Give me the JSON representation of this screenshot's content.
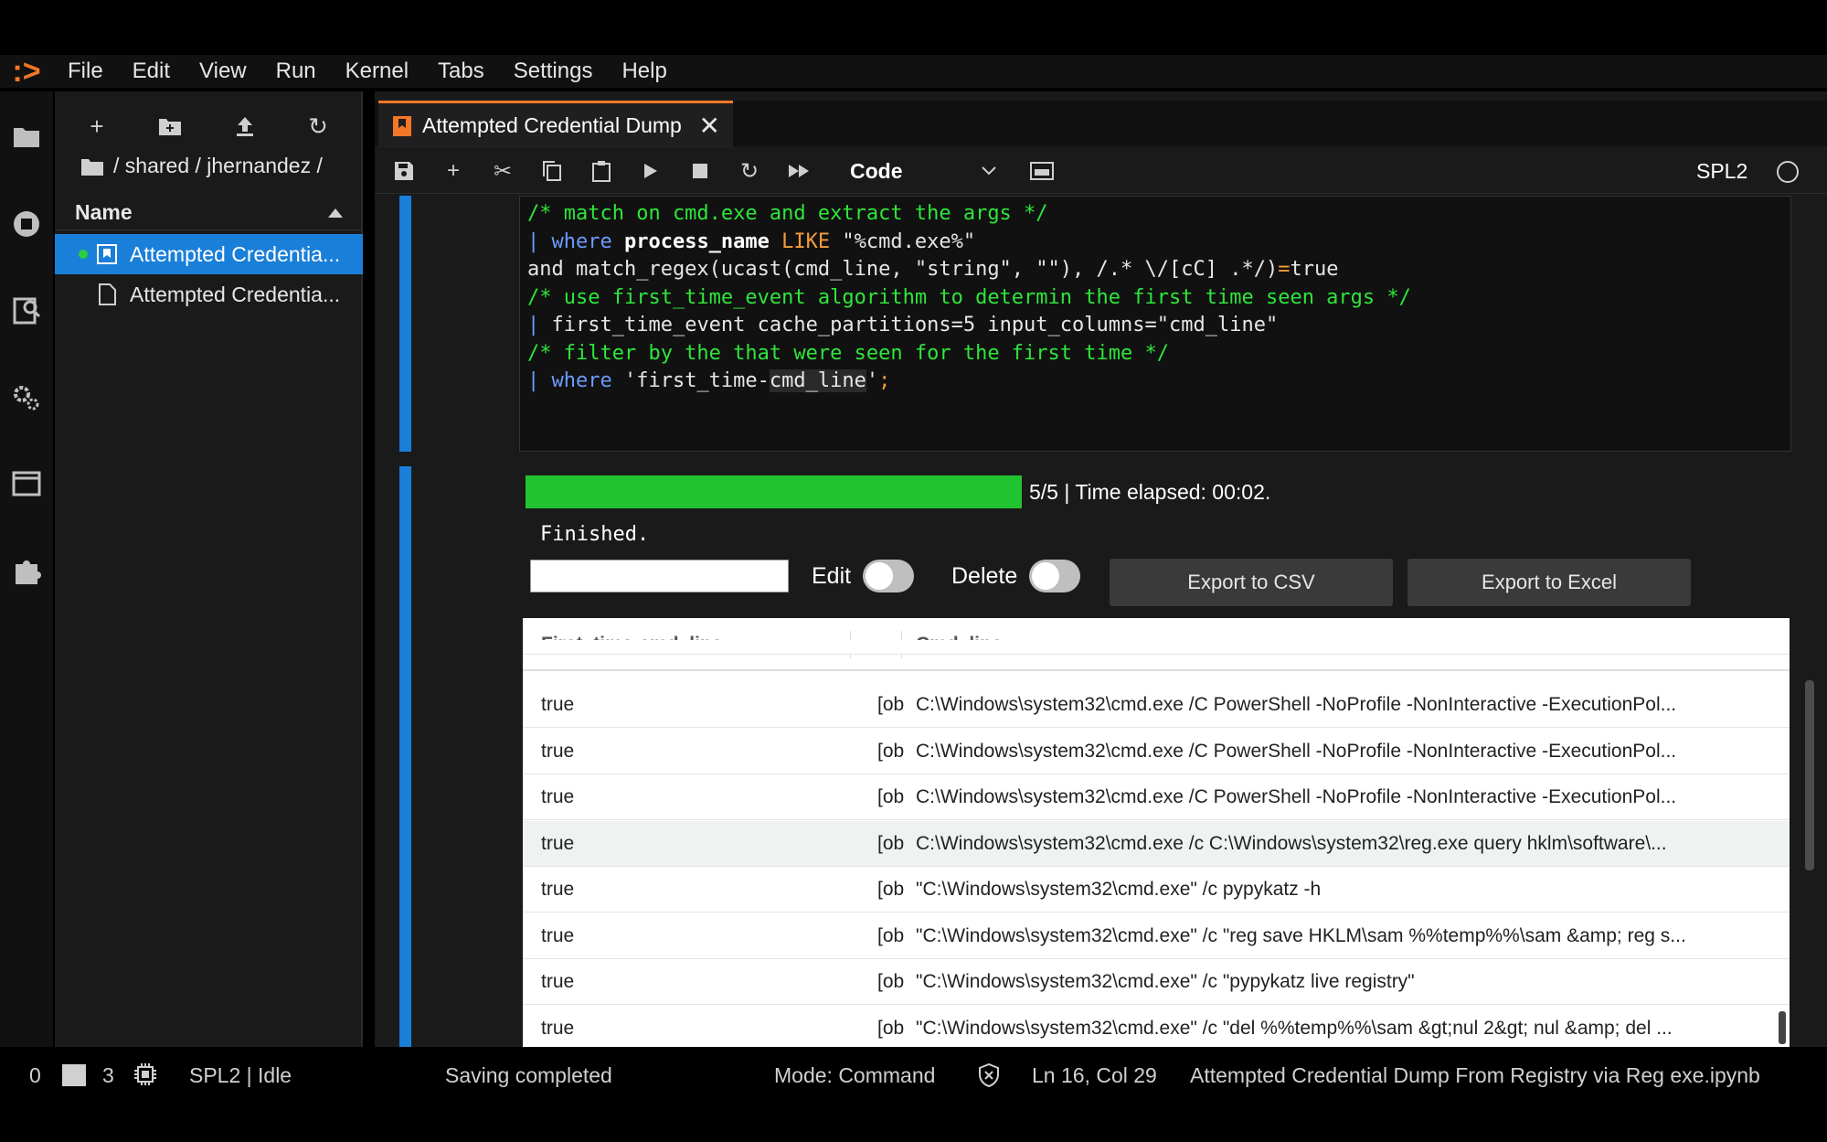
{
  "menubar": {
    "logo": ":>",
    "items": [
      "File",
      "Edit",
      "View",
      "Run",
      "Kernel",
      "Tabs",
      "Settings",
      "Help"
    ]
  },
  "activity_icons": [
    "folder-icon",
    "running-icon",
    "property-inspector-icon",
    "gear-icon",
    "window-icon",
    "extension-icon"
  ],
  "filebrowser": {
    "toolbar_icons": [
      "new-launcher-icon",
      "new-folder-icon",
      "upload-icon",
      "refresh-icon"
    ],
    "breadcrumb": "/ shared / jhernandez /",
    "column_header": "Name",
    "files": [
      {
        "name": "Attempted Credentia...",
        "selected": true,
        "running": true
      },
      {
        "name": "Attempted Credentia...",
        "selected": false,
        "running": false
      }
    ]
  },
  "tab": {
    "title": "Attempted Credential Dump",
    "accent": "#f37726"
  },
  "notebook_toolbar": {
    "cell_type": "Code",
    "kernel": "SPL2"
  },
  "code_lines": [
    "/* match on cmd.exe and extract the args */",
    "| where process_name LIKE \"%cmd.exe%\"",
    "and match_regex(ucast(cmd_line, \"string\", \"\"), /.* \\/[cC] .*/)=true",
    "/* use first_time_event algorithm to determin the first time seen args */",
    "| first_time_event cache_partitions=5 input_columns=\"cmd_line\"",
    "/* filter by the that were seen for the first time */",
    "| where 'first_time-cmd_line';"
  ],
  "output": {
    "progress_fraction": 1.0,
    "progress_color": "#22c331",
    "progress_text": "5/5 | Time elapsed: 00:02.",
    "status": "Finished.",
    "search_value": "",
    "edit_label": "Edit",
    "delete_label": "Delete",
    "export_csv_label": "Export to CSV",
    "export_excel_label": "Export to Excel"
  },
  "table": {
    "columns": [
      "First_time-cmd_line",
      "Cmd_line"
    ],
    "rows": [
      {
        "first": "true",
        "mid": "[ob",
        "cmd": "C:\\Windows\\system32\\cmd.exe /C PowerShell -NoProfile -NonInteractive -ExecutionPol..."
      },
      {
        "first": "true",
        "mid": "[ob",
        "cmd": "C:\\Windows\\system32\\cmd.exe /C PowerShell -NoProfile -NonInteractive -ExecutionPol..."
      },
      {
        "first": "true",
        "mid": "[ob",
        "cmd": "C:\\Windows\\system32\\cmd.exe /C PowerShell -NoProfile -NonInteractive -ExecutionPol..."
      },
      {
        "first": "true",
        "mid": "[ob",
        "cmd": "C:\\Windows\\system32\\cmd.exe /c C:\\Windows\\system32\\reg.exe query hklm\\software\\..."
      },
      {
        "first": "true",
        "mid": "[ob",
        "cmd": "\"C:\\Windows\\system32\\cmd.exe\" /c pypykatz -h"
      },
      {
        "first": "true",
        "mid": "[ob",
        "cmd": "\"C:\\Windows\\system32\\cmd.exe\" /c \"reg save HKLM\\sam %%temp%%\\sam &amp; reg s..."
      },
      {
        "first": "true",
        "mid": "[ob",
        "cmd": "\"C:\\Windows\\system32\\cmd.exe\" /c \"pypykatz live registry\""
      },
      {
        "first": "true",
        "mid": "[ob",
        "cmd": "\"C:\\Windows\\system32\\cmd.exe\" /c \"del %%temp%%\\sam &gt;nul 2&gt; nul &amp; del ..."
      }
    ]
  },
  "statusbar": {
    "count_a": "0",
    "count_b": "3",
    "kernel_status": "SPL2 | Idle",
    "saving": "Saving completed",
    "mode": "Mode: Command",
    "position": "Ln 16, Col 29",
    "filename": "Attempted Credential Dump From Registry via Reg exe.ipynb"
  }
}
